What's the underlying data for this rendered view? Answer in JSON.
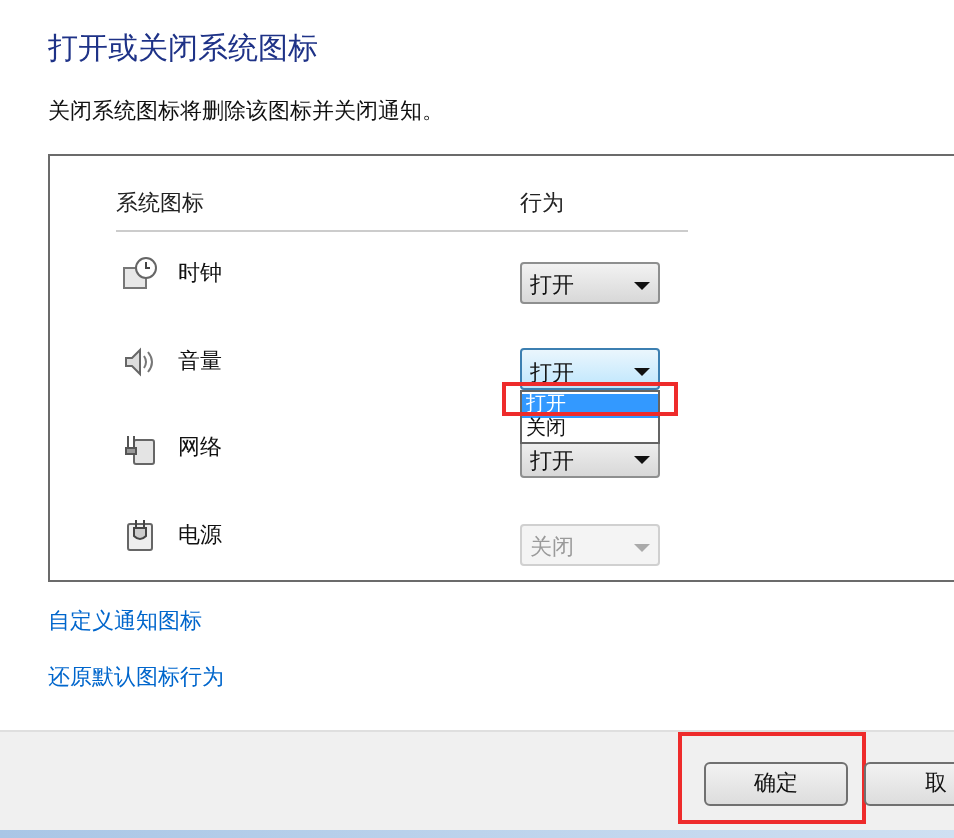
{
  "title": "打开或关闭系统图标",
  "description": "关闭系统图标将删除该图标并关闭通知。",
  "table": {
    "columns": [
      "系统图标",
      "行为"
    ],
    "rows": [
      {
        "kind": "clock",
        "name": "时钟",
        "behavior": "打开",
        "disabled": false,
        "focused": false,
        "open": false
      },
      {
        "kind": "speaker",
        "name": "音量",
        "behavior": "打开",
        "disabled": false,
        "focused": true,
        "open": true
      },
      {
        "kind": "network",
        "name": "网络",
        "behavior": "打开",
        "disabled": false,
        "focused": false,
        "open": false
      },
      {
        "kind": "power",
        "name": "电源",
        "behavior": "关闭",
        "disabled": true,
        "focused": false,
        "open": false
      }
    ]
  },
  "dropdown_menu": {
    "options": [
      {
        "label": "打开",
        "selected": true,
        "highlighted": true
      },
      {
        "label": "关闭",
        "selected": false,
        "highlighted": false
      }
    ]
  },
  "links": [
    "自定义通知图标",
    "还原默认图标行为"
  ],
  "buttons": [
    {
      "label": "确定",
      "highlighted": true
    },
    {
      "label": "取",
      "highlighted": false
    }
  ]
}
